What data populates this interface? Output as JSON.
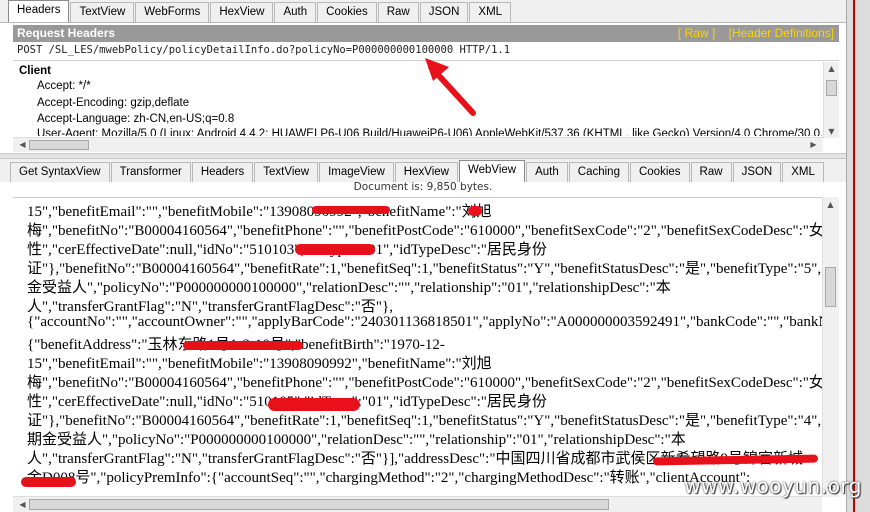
{
  "request_tabs": [
    "Headers",
    "TextView",
    "WebForms",
    "HexView",
    "Auth",
    "Cookies",
    "Raw",
    "JSON",
    "XML"
  ],
  "request_active_tab": "Headers",
  "request_headers": {
    "title": "Request Headers",
    "raw_link": "[ Raw ]",
    "defs_link": "[Header Definitions]",
    "request_line": "POST /SL_LES/mwebPolicy/policyDetailInfo.do?policyNo=P000000000100000 HTTP/1.1",
    "section": "Client",
    "lines": [
      "Accept: */*",
      "Accept-Encoding: gzip,deflate",
      "Accept-Language: zh-CN,en-US;q=0.8",
      "User-Agent: Mozilla/5.0 (Linux; Android 4.4.2; HUAWEI P6-U06 Build/HuaweiP6-U06) AppleWebKit/537.36 (KHTML, like Gecko) Version/4.0 Chrome/30.0.0.0 Mobile"
    ]
  },
  "response_tabs": [
    "Get SyntaxView",
    "Transformer",
    "Headers",
    "TextView",
    "ImageView",
    "HexView",
    "WebView",
    "Auth",
    "Caching",
    "Cookies",
    "Raw",
    "JSON",
    "XML"
  ],
  "response_active_tab": "WebView",
  "document_info": "Document is: 9,850 bytes.",
  "body_lines": [
    "15\",\"benefitEmail\":\"\",\"benefitMobile\":\"13908090992\",\"benefitName\":\"刘旭",
    "梅\",\"benefitNo\":\"B00004160564\",\"benefitPhone\":\"\",\"benefitPostCode\":\"610000\",\"benefitSexCode\":\"2\",\"benefitSexCodeDesc\":\"女",
    "性\",\"cerEffectiveDate\":null,\"idNo\":\"510103\",\"idType\":\"01\",\"idTypeDesc\":\"居民身份",
    "证\"},\"benefitNo\":\"B00004160564\",\"benefitRate\":1,\"benefitSeq\":1,\"benefitStatus\":\"Y\",\"benefitStatusDesc\":\"是\",\"benefitType\":\"5\",\"benefitTypeDesc\":\"",
    "金受益人\",\"policyNo\":\"P000000000100000\",\"relationDesc\":\"\",\"relationship\":\"01\",\"relationshipDesc\":\"本",
    "人\",\"transferGrantFlag\":\"N\",\"transferGrantFlagDesc\":\"否\"},",
    "{\"accountNo\":\"\",\"accountOwner\":\"\",\"applyBarCode\":\"240301136818501\",\"applyNo\":\"A000000003592491\",\"bankCode\":\"\",\"bankName\":\"",
    "{\"benefitAddress\":\"玉林东路1号1-3-10号\",\"benefitBirth\":\"1970-12-",
    "15\",\"benefitEmail\":\"\",\"benefitMobile\":\"13908090992\",\"benefitName\":\"刘旭",
    "梅\",\"benefitNo\":\"B00004160564\",\"benefitPhone\":\"\",\"benefitPostCode\":\"610000\",\"benefitSexCode\":\"2\",\"benefitSexCodeDesc\":\"女",
    "性\",\"cerEffectiveDate\":null,\"idNo\":\"510105\",\"idType\":\"01\",\"idTypeDesc\":\"居民身份",
    "证\"},\"benefitNo\":\"B00004160564\",\"benefitRate\":1,\"benefitSeq\":1,\"benefitStatus\":\"Y\",\"benefitStatusDesc\":\"是\",\"benefitType\":\"4\",\"benefitTypeDesc\":\"",
    "期金受益人\",\"policyNo\":\"P000000000100000\",\"relationDesc\":\"\",\"relationship\":\"01\",\"relationshipDesc\":\"本",
    "人\",\"transferGrantFlag\":\"N\",\"transferGrantFlagDesc\":\"否\"}],\"addressDesc\":\"中国四川省成都市武侯区新希望路9号锦官新城",
    "金D008号\",\"policyPremInfo\":{\"accountSeq\":\"\",\"chargingMethod\":\"2\",\"chargingMethodDesc\":\"转账\",\"clientAccount\":"
  ],
  "watermark": "www.wooyun.org",
  "colors": {
    "header_bar": "#999999",
    "header_links": "#ffd200",
    "annotation": "#e8101a"
  }
}
